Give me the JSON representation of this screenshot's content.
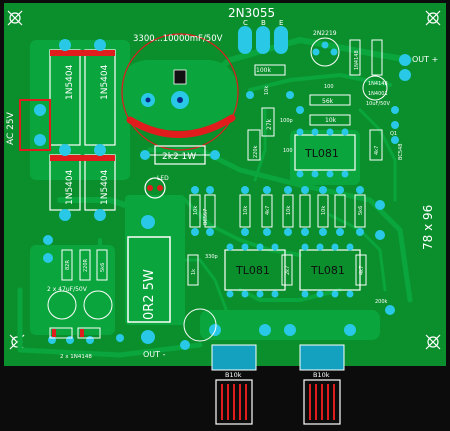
{
  "board": {
    "colors": {
      "board": "#0a8f2c",
      "copper": "#0aa53c",
      "pad": "#28c8e6",
      "silk": "#ffffff",
      "jumper": "#e01c1c",
      "background": "#0c0c0c"
    },
    "labels": {
      "transistor_power": "2N3055",
      "pins_c": "C",
      "pins_b": "B",
      "pins_e": "E",
      "capacitor_main": "3300...10000mF/50V",
      "transistor_driver": "2N2219",
      "diode_1": "1N5404",
      "diode_2": "1N5404",
      "diode_3": "1N5404",
      "diode_4": "1N5404",
      "ac_input": "AC 25V",
      "resistor_2k2": "2k2 1W",
      "led": "LED",
      "resistor_0r2": "0R2 5W",
      "out_plus": "OUT +",
      "out_minus": "OUT -",
      "r100k_top": "100k",
      "r10k_left": "10k",
      "r100_a": "100",
      "r56k": "56k",
      "r10k_mid": "10k",
      "r27k": "27k",
      "c100p": "100p",
      "r220k": "220k",
      "r100_b": "100",
      "ic_top": "TL081",
      "d_1n4148_top": "1N4148",
      "d_1n4148_mid": "1N4148",
      "d_1n4001": "1N4001",
      "cap_10uf": "10uF/50V",
      "transistor_q1": "Q1",
      "transistor_bc548": "BC548",
      "r_4k7": "4k7",
      "transistor_bc557": "BC557",
      "r_10k_c": "10k",
      "r_10k_d": "10k",
      "r_4k7_b": "4k7",
      "r_10k_e": "10k",
      "r_10k_f": "10k",
      "r_5k6": "5k6",
      "r_1k_a": "1k",
      "c330p": "330p",
      "ic_left": "TL081",
      "r_2k7_a": "2k7",
      "ic_right": "TL081",
      "r_4k7_c": "4k7",
      "r_200k": "200k",
      "r_82r": "82R",
      "r_220r": "220R",
      "r_5k6_b": "5k6",
      "cap_47uf": "2 x 47uF/50V",
      "diodes_1n4148": "2 x 1N4148",
      "pot_left": "B10k",
      "pot_right": "B10k",
      "dimensions": "78 x 96"
    }
  }
}
